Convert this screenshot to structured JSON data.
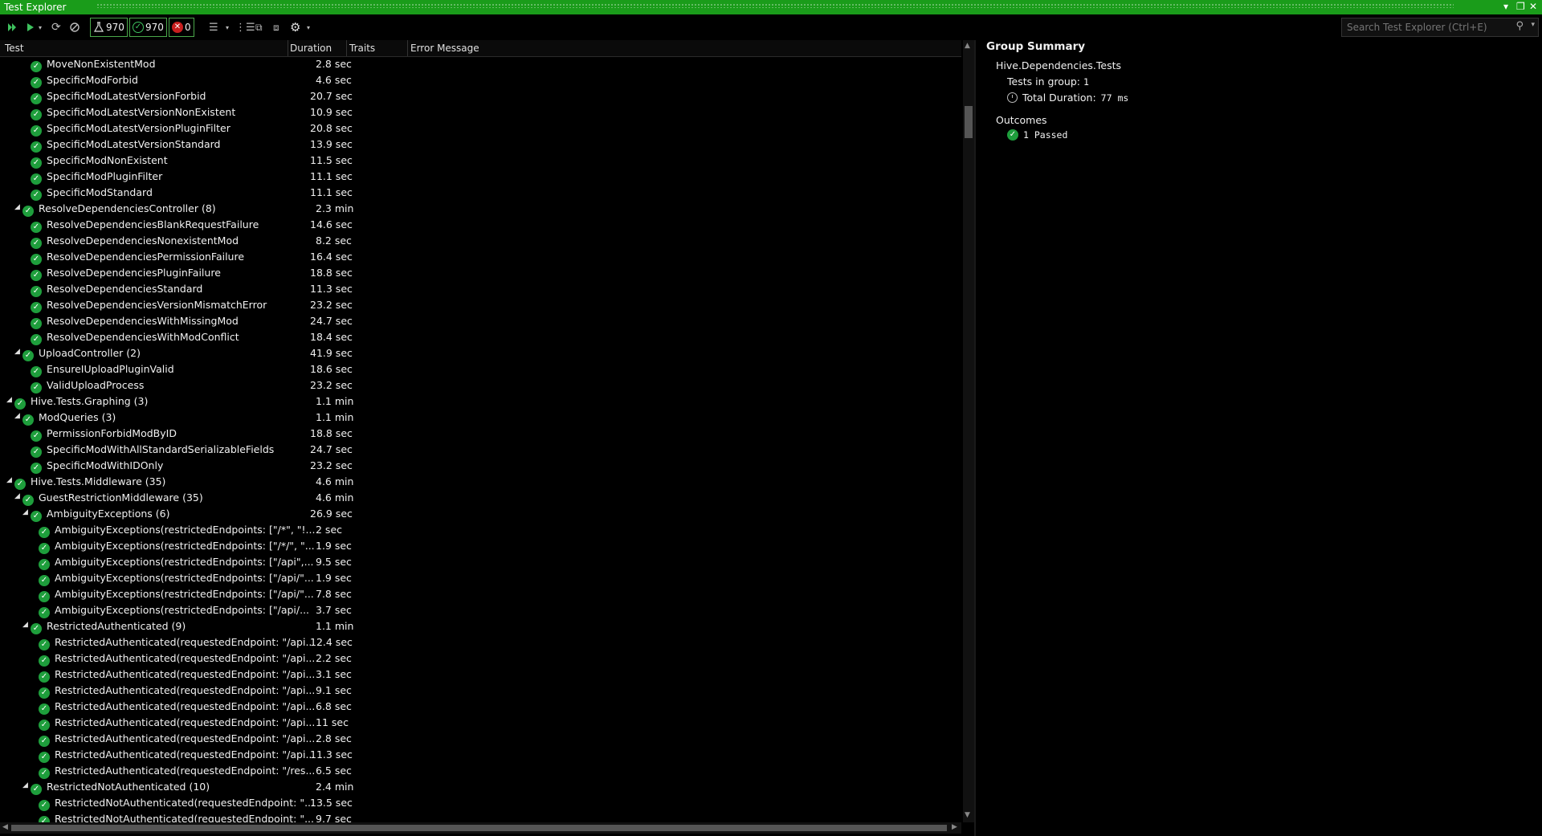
{
  "window": {
    "title": "Test Explorer"
  },
  "toolbar": {
    "total_count": "970",
    "passed_count": "970",
    "failed_count": "0",
    "search_placeholder": "Search Test Explorer (Ctrl+E)",
    "icons": [
      "run-all-icon",
      "run-icon",
      "refresh-icon",
      "cancel-icon",
      "flask-icon",
      "passed-icon",
      "failed-icon",
      "playlist-icon",
      "group-by-icon",
      "expand-icon",
      "collapse-icon",
      "settings-icon",
      "search-icon"
    ]
  },
  "grid": {
    "columns": [
      "Test",
      "Duration",
      "Traits",
      "Error Message"
    ],
    "rows": [
      {
        "level": 3,
        "expander": false,
        "name": "MoveNonExistentMod",
        "duration": "2.8 sec"
      },
      {
        "level": 3,
        "expander": false,
        "name": "SpecificModForbid",
        "duration": "4.6 sec"
      },
      {
        "level": 3,
        "expander": false,
        "name": "SpecificModLatestVersionForbid",
        "duration": "20.7 sec"
      },
      {
        "level": 3,
        "expander": false,
        "name": "SpecificModLatestVersionNonExistent",
        "duration": "10.9 sec"
      },
      {
        "level": 3,
        "expander": false,
        "name": "SpecificModLatestVersionPluginFilter",
        "duration": "20.8 sec"
      },
      {
        "level": 3,
        "expander": false,
        "name": "SpecificModLatestVersionStandard",
        "duration": "13.9 sec"
      },
      {
        "level": 3,
        "expander": false,
        "name": "SpecificModNonExistent",
        "duration": "11.5 sec"
      },
      {
        "level": 3,
        "expander": false,
        "name": "SpecificModPluginFilter",
        "duration": "11.1 sec"
      },
      {
        "level": 3,
        "expander": false,
        "name": "SpecificModStandard",
        "duration": "11.1 sec"
      },
      {
        "level": 2,
        "expander": true,
        "name": "ResolveDependenciesController (8)",
        "duration": "2.3 min"
      },
      {
        "level": 3,
        "expander": false,
        "name": "ResolveDependenciesBlankRequestFailure",
        "duration": "14.6 sec"
      },
      {
        "level": 3,
        "expander": false,
        "name": "ResolveDependenciesNonexistentMod",
        "duration": "8.2 sec"
      },
      {
        "level": 3,
        "expander": false,
        "name": "ResolveDependenciesPermissionFailure",
        "duration": "16.4 sec"
      },
      {
        "level": 3,
        "expander": false,
        "name": "ResolveDependenciesPluginFailure",
        "duration": "18.8 sec"
      },
      {
        "level": 3,
        "expander": false,
        "name": "ResolveDependenciesStandard",
        "duration": "11.3 sec"
      },
      {
        "level": 3,
        "expander": false,
        "name": "ResolveDependenciesVersionMismatchError",
        "duration": "23.2 sec"
      },
      {
        "level": 3,
        "expander": false,
        "name": "ResolveDependenciesWithMissingMod",
        "duration": "24.7 sec"
      },
      {
        "level": 3,
        "expander": false,
        "name": "ResolveDependenciesWithModConflict",
        "duration": "18.4 sec"
      },
      {
        "level": 2,
        "expander": true,
        "name": "UploadController (2)",
        "duration": "41.9 sec"
      },
      {
        "level": 3,
        "expander": false,
        "name": "EnsureIUploadPluginValid",
        "duration": "18.6 sec"
      },
      {
        "level": 3,
        "expander": false,
        "name": "ValidUploadProcess",
        "duration": "23.2 sec"
      },
      {
        "level": 1,
        "expander": true,
        "name": "Hive.Tests.Graphing (3)",
        "duration": "1.1 min"
      },
      {
        "level": 2,
        "expander": true,
        "name": "ModQueries (3)",
        "duration": "1.1 min"
      },
      {
        "level": 3,
        "expander": false,
        "name": "PermissionForbidModByID",
        "duration": "18.8 sec"
      },
      {
        "level": 3,
        "expander": false,
        "name": "SpecificModWithAllStandardSerializableFields",
        "duration": "24.7 sec"
      },
      {
        "level": 3,
        "expander": false,
        "name": "SpecificModWithIDOnly",
        "duration": "23.2 sec"
      },
      {
        "level": 1,
        "expander": true,
        "name": "Hive.Tests.Middleware (35)",
        "duration": "4.6 min"
      },
      {
        "level": 2,
        "expander": true,
        "name": "GuestRestrictionMiddleware (35)",
        "duration": "4.6 min"
      },
      {
        "level": 3,
        "expander": true,
        "name": "AmbiguityExceptions (6)",
        "duration": "26.9 sec"
      },
      {
        "level": 4,
        "expander": false,
        "name": "AmbiguityExceptions(restrictedEndpoints: [\"/*\", \"!...",
        "duration": "2 sec"
      },
      {
        "level": 4,
        "expander": false,
        "name": "AmbiguityExceptions(restrictedEndpoints: [\"/*/\", \"...",
        "duration": "1.9 sec"
      },
      {
        "level": 4,
        "expander": false,
        "name": "AmbiguityExceptions(restrictedEndpoints: [\"/api\",...",
        "duration": "9.5 sec"
      },
      {
        "level": 4,
        "expander": false,
        "name": "AmbiguityExceptions(restrictedEndpoints: [\"/api/\"...",
        "duration": "1.9 sec"
      },
      {
        "level": 4,
        "expander": false,
        "name": "AmbiguityExceptions(restrictedEndpoints: [\"/api/\"...",
        "duration": "7.8 sec"
      },
      {
        "level": 4,
        "expander": false,
        "name": "AmbiguityExceptions(restrictedEndpoints: [\"/api/...",
        "duration": "3.7 sec"
      },
      {
        "level": 3,
        "expander": true,
        "name": "RestrictedAuthenticated (9)",
        "duration": "1.1 min"
      },
      {
        "level": 4,
        "expander": false,
        "name": "RestrictedAuthenticated(requestedEndpoint: \"/api...",
        "duration": "12.4 sec"
      },
      {
        "level": 4,
        "expander": false,
        "name": "RestrictedAuthenticated(requestedEndpoint: \"/api...",
        "duration": "2.2 sec"
      },
      {
        "level": 4,
        "expander": false,
        "name": "RestrictedAuthenticated(requestedEndpoint: \"/api...",
        "duration": "3.1 sec"
      },
      {
        "level": 4,
        "expander": false,
        "name": "RestrictedAuthenticated(requestedEndpoint: \"/api...",
        "duration": "9.1 sec"
      },
      {
        "level": 4,
        "expander": false,
        "name": "RestrictedAuthenticated(requestedEndpoint: \"/api...",
        "duration": "6.8 sec"
      },
      {
        "level": 4,
        "expander": false,
        "name": "RestrictedAuthenticated(requestedEndpoint: \"/api...",
        "duration": "11 sec"
      },
      {
        "level": 4,
        "expander": false,
        "name": "RestrictedAuthenticated(requestedEndpoint: \"/api...",
        "duration": "2.8 sec"
      },
      {
        "level": 4,
        "expander": false,
        "name": "RestrictedAuthenticated(requestedEndpoint: \"/api...",
        "duration": "11.3 sec"
      },
      {
        "level": 4,
        "expander": false,
        "name": "RestrictedAuthenticated(requestedEndpoint: \"/res...",
        "duration": "6.5 sec"
      },
      {
        "level": 3,
        "expander": true,
        "name": "RestrictedNotAuthenticated (10)",
        "duration": "2.4 min"
      },
      {
        "level": 4,
        "expander": false,
        "name": "RestrictedNotAuthenticated(requestedEndpoint: \"...",
        "duration": "13.5 sec"
      },
      {
        "level": 4,
        "expander": false,
        "name": "RestrictedNotAuthenticated(requestedEndpoint: \"...",
        "duration": "9.7 sec"
      }
    ]
  },
  "summary": {
    "heading": "Group Summary",
    "group_name": "Hive.Dependencies.Tests",
    "tests_label": "Tests in group:",
    "tests_value": "1",
    "duration_label": "Total Duration:",
    "duration_value": "77 ms",
    "outcomes_heading": "Outcomes",
    "outcome_passed": "1 Passed"
  },
  "colors": {
    "accent": "#1a9c1a",
    "passed": "#1e9e3c",
    "failed": "#c81e1e",
    "background": "#000000"
  }
}
